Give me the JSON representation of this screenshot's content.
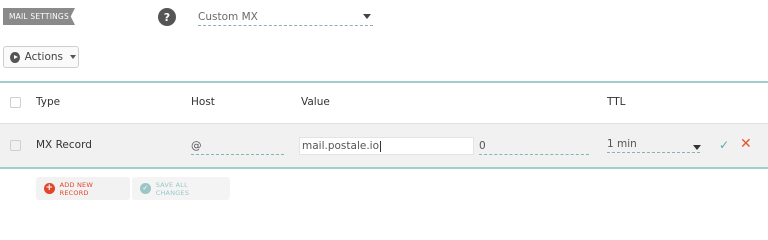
{
  "mail_settings": {
    "label": "MAIL SETTINGS",
    "help_icon": "?",
    "selected_option": "Custom MX"
  },
  "actions": {
    "label": "Actions"
  },
  "table": {
    "headers": {
      "type": "Type",
      "host": "Host",
      "value": "Value",
      "ttl": "TTL"
    },
    "row": {
      "type": "MX Record",
      "host": "@",
      "value": "mail.postale.io",
      "priority": "0",
      "ttl": "1 min"
    },
    "icons": {
      "confirm": "✓",
      "remove": "✕"
    }
  },
  "footer": {
    "add_record_label": "ADD NEW RECORD",
    "add_icon": "+",
    "save_label": "SAVE ALL CHANGES",
    "save_icon": "✓"
  },
  "colors": {
    "accent": "#7fb6b8",
    "danger": "#e2452a",
    "row_bg": "#f1f1f1"
  }
}
